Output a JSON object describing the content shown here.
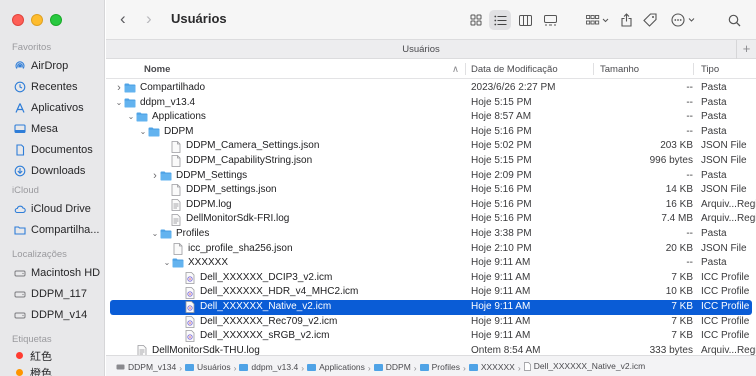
{
  "window": {
    "title": "Usuários"
  },
  "tab": {
    "label": "Usuários",
    "add": "+"
  },
  "sidebar": {
    "favorites_heading": "Favoritos",
    "favorites": [
      {
        "label": "AirDrop",
        "icon": "airdrop-icon"
      },
      {
        "label": "Recentes",
        "icon": "clock-icon"
      },
      {
        "label": "Aplicativos",
        "icon": "apps-icon"
      },
      {
        "label": "Mesa",
        "icon": "desktop-icon"
      },
      {
        "label": "Documentos",
        "icon": "document-icon"
      },
      {
        "label": "Downloads",
        "icon": "download-icon"
      }
    ],
    "icloud_heading": "iCloud",
    "icloud": [
      {
        "label": "iCloud Drive",
        "icon": "cloud-icon"
      },
      {
        "label": "Compartilha...",
        "icon": "shared-folder-icon"
      }
    ],
    "locations_heading": "Localizações",
    "locations": [
      {
        "label": "Macintosh HD",
        "icon": "disk-icon"
      },
      {
        "label": "DDPM_117",
        "icon": "disk-icon"
      },
      {
        "label": "DDPM_v14",
        "icon": "disk-icon"
      }
    ],
    "tags_heading": "Etiquetas",
    "tags": [
      {
        "label": "紅色",
        "color": "#ff3b30"
      },
      {
        "label": "橙色",
        "color": "#ff9500"
      }
    ]
  },
  "columns": {
    "name": "Nome",
    "date": "Data de Modificação",
    "size": "Tamanho",
    "kind": "Tipo"
  },
  "rows": [
    {
      "name": "Compartilhado",
      "date": "2023/6/26 2:27 PM",
      "size": "--",
      "kind": "Pasta",
      "type": "folder",
      "disc": "right"
    },
    {
      "name": "ddpm_v13.4",
      "date": "Hoje 5:15 PM",
      "size": "--",
      "kind": "Pasta",
      "type": "folder",
      "disc": "down"
    },
    {
      "name": "Applications",
      "date": "Hoje 8:57 AM",
      "size": "--",
      "kind": "Pasta",
      "type": "folder",
      "disc": "down"
    },
    {
      "name": "DDPM",
      "date": "Hoje 5:16 PM",
      "size": "--",
      "kind": "Pasta",
      "type": "folder",
      "disc": "down"
    },
    {
      "name": "DDPM_Camera_Settings.json",
      "date": "Hoje 5:02 PM",
      "size": "203 KB",
      "kind": "JSON File",
      "type": "file",
      "disc": ""
    },
    {
      "name": "DDPM_CapabilityString.json",
      "date": "Hoje 5:15 PM",
      "size": "996 bytes",
      "kind": "JSON File",
      "type": "file",
      "disc": ""
    },
    {
      "name": "DDPM_Settings",
      "date": "Hoje 2:09 PM",
      "size": "--",
      "kind": "Pasta",
      "type": "folder",
      "disc": "right"
    },
    {
      "name": "DDPM_settings.json",
      "date": "Hoje 5:16 PM",
      "size": "14 KB",
      "kind": "JSON File",
      "type": "file",
      "disc": ""
    },
    {
      "name": "DDPM.log",
      "date": "Hoje 5:16 PM",
      "size": "16 KB",
      "kind": "Arquiv...Registro",
      "type": "log",
      "disc": ""
    },
    {
      "name": "DellMonitorSdk-FRI.log",
      "date": "Hoje 5:16 PM",
      "size": "7.4 MB",
      "kind": "Arquiv...Registro",
      "type": "log",
      "disc": ""
    },
    {
      "name": "Profiles",
      "date": "Hoje 3:38 PM",
      "size": "--",
      "kind": "Pasta",
      "type": "folder",
      "disc": "down"
    },
    {
      "name": "icc_profile_sha256.json",
      "date": "Hoje 2:10 PM",
      "size": "20 KB",
      "kind": "JSON File",
      "type": "file",
      "disc": ""
    },
    {
      "name": "XXXXXX",
      "date": "Hoje 9:11 AM",
      "size": "--",
      "kind": "Pasta",
      "type": "folder",
      "disc": "down"
    },
    {
      "name": "Dell_XXXXXX_DCIP3_v2.icm",
      "date": "Hoje 9:11 AM",
      "size": "7 KB",
      "kind": "ICC Profile",
      "type": "icc",
      "disc": ""
    },
    {
      "name": "Dell_XXXXXX_HDR_v4_MHC2.icm",
      "date": "Hoje 9:11 AM",
      "size": "10 KB",
      "kind": "ICC Profile",
      "type": "icc",
      "disc": ""
    },
    {
      "name": "Dell_XXXXXX_Native_v2.icm",
      "date": "Hoje 9:11 AM",
      "size": "7 KB",
      "kind": "ICC Profile",
      "type": "icc",
      "disc": "",
      "selected": true
    },
    {
      "name": "Dell_XXXXXX_Rec709_v2.icm",
      "date": "Hoje 9:11 AM",
      "size": "7 KB",
      "kind": "ICC Profile",
      "type": "icc",
      "disc": ""
    },
    {
      "name": "Dell_XXXXXX_sRGB_v2.icm",
      "date": "Hoje 9:11 AM",
      "size": "7 KB",
      "kind": "ICC Profile",
      "type": "icc",
      "disc": ""
    },
    {
      "name": "DellMonitorSdk-THU.log",
      "date": "Ontem 8:54 AM",
      "size": "333 bytes",
      "kind": "Arquiv...Registro",
      "type": "log",
      "disc": ""
    }
  ],
  "pathbar": [
    "DDPM_v134",
    "Usuários",
    "ddpm_v13.4",
    "Applications",
    "DDPM",
    "Profiles",
    "XXXXXX",
    "Dell_XXXXXX_Native_v2.icm"
  ],
  "accent": "#0a5cd6",
  "folder_color": "#4fa3e6"
}
